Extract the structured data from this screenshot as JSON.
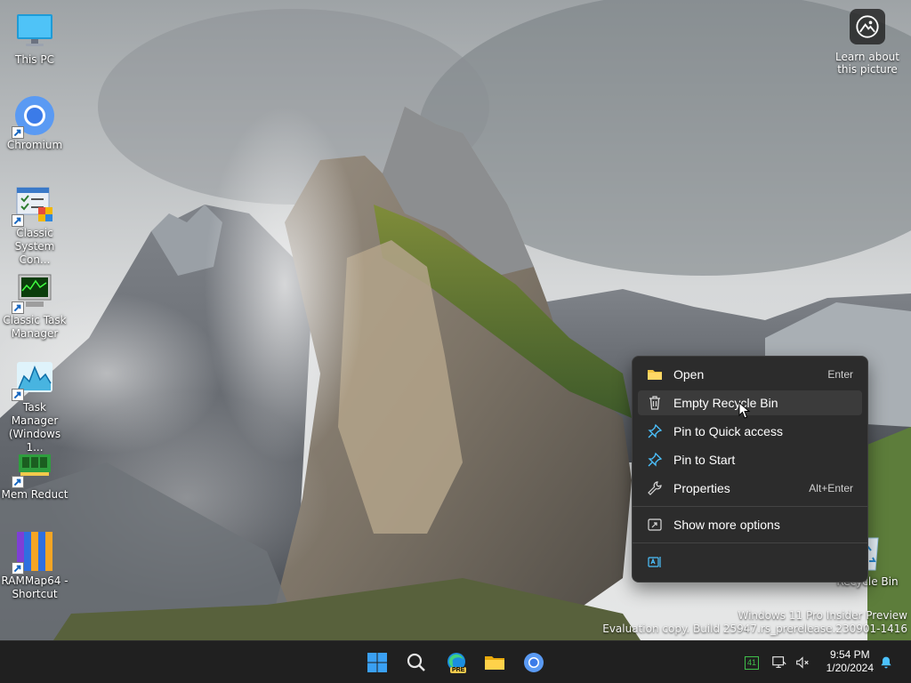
{
  "desktop": {
    "icons": [
      {
        "label": "This PC"
      },
      {
        "label": "Chromium"
      },
      {
        "label": "Classic System Con..."
      },
      {
        "label": "Classic Task Manager"
      },
      {
        "label": "Task Manager (Windows 1..."
      },
      {
        "label": "Mem Reduct"
      },
      {
        "label": "RAMMap64 - Shortcut"
      },
      {
        "label": "Recycle Bin"
      }
    ],
    "learn_about_picture": "Learn about this picture",
    "watermark_line1": "Windows 11 Pro Insider Preview",
    "watermark_line2": "Evaluation copy. Build 25947.rs_prerelease.230901-1416"
  },
  "context_menu": {
    "items": [
      {
        "label": "Open",
        "shortcut": "Enter",
        "icon": "folder-icon"
      },
      {
        "label": "Empty Recycle Bin",
        "shortcut": "",
        "icon": "trash-icon"
      },
      {
        "label": "Pin to Quick access",
        "shortcut": "",
        "icon": "pin-icon"
      },
      {
        "label": "Pin to Start",
        "shortcut": "",
        "icon": "pin-icon"
      },
      {
        "label": "Properties",
        "shortcut": "Alt+Enter",
        "icon": "wrench-icon"
      },
      {
        "label": "Show more options",
        "shortcut": "",
        "icon": "share-icon"
      }
    ],
    "hovered": "Empty Recycle Bin"
  },
  "taskbar": {
    "apps": [
      "start-icon",
      "search-icon",
      "edge-preview-icon",
      "file-explorer-icon",
      "chromium-icon"
    ],
    "edge_badge": "PRE",
    "tray_badge": "41",
    "time": "9:54 PM",
    "date": "1/20/2024"
  },
  "colors": {
    "taskbar": "#202020",
    "menu_bg": "#2c2c2c",
    "menu_hover": "#3b3b3b",
    "pin_blue": "#4cc2ff"
  }
}
